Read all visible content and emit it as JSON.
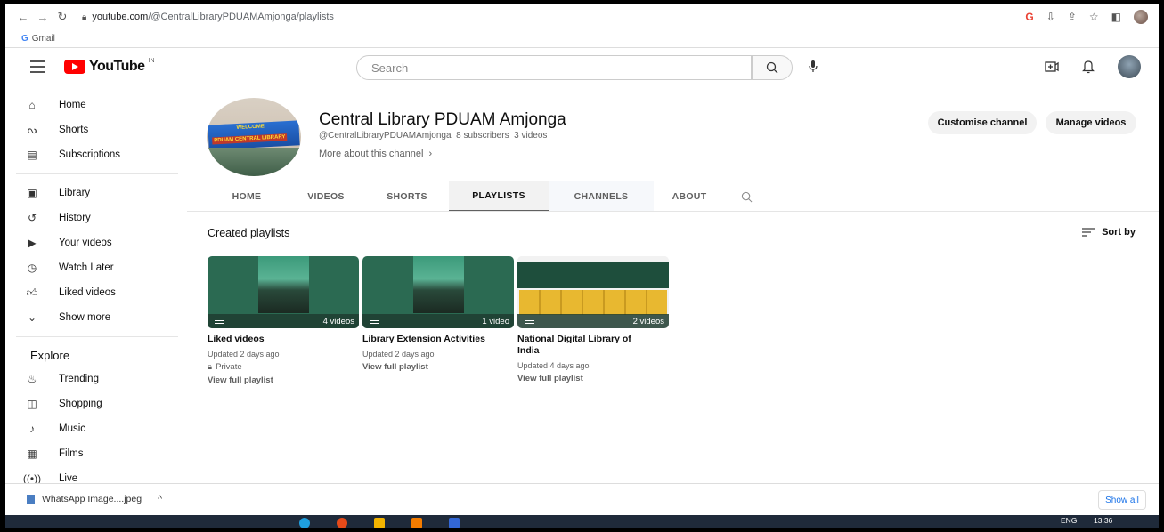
{
  "browser": {
    "url_host": "youtube.com",
    "url_path": "/@CentralLibraryPDUAMAmjonga/playlists",
    "bookmark": "Gmail"
  },
  "header": {
    "logo_text": "YouTube",
    "region": "IN",
    "search_placeholder": "Search"
  },
  "sidebar": {
    "main": [
      {
        "label": "Home",
        "icon": "home-icon"
      },
      {
        "label": "Shorts",
        "icon": "shorts-icon"
      },
      {
        "label": "Subscriptions",
        "icon": "subscriptions-icon"
      }
    ],
    "library": [
      {
        "label": "Library",
        "icon": "library-icon"
      },
      {
        "label": "History",
        "icon": "history-icon"
      },
      {
        "label": "Your videos",
        "icon": "your-videos-icon"
      },
      {
        "label": "Watch Later",
        "icon": "watch-later-icon"
      },
      {
        "label": "Liked videos",
        "icon": "liked-videos-icon"
      },
      {
        "label": "Show more",
        "icon": "chevron-down-icon"
      }
    ],
    "explore_heading": "Explore",
    "explore": [
      {
        "label": "Trending",
        "icon": "trending-icon"
      },
      {
        "label": "Shopping",
        "icon": "shopping-icon"
      },
      {
        "label": "Music",
        "icon": "music-icon"
      },
      {
        "label": "Films",
        "icon": "films-icon"
      },
      {
        "label": "Live",
        "icon": "live-icon"
      }
    ]
  },
  "channel": {
    "name": "Central Library PDUAM Amjonga",
    "handle": "@CentralLibraryPDUAMAmjonga",
    "subscribers": "8 subscribers",
    "videos": "3 videos",
    "more_about": "More about this channel",
    "avatar_sign_line1": "WELCOME",
    "avatar_sign_line2": "PDUAM CENTRAL LIBRARY",
    "customise_label": "Customise channel",
    "manage_label": "Manage videos"
  },
  "tabs": [
    {
      "label": "HOME",
      "active": false
    },
    {
      "label": "VIDEOS",
      "active": false
    },
    {
      "label": "SHORTS",
      "active": false
    },
    {
      "label": "PLAYLISTS",
      "active": true
    },
    {
      "label": "CHANNELS",
      "active": false
    },
    {
      "label": "ABOUT",
      "active": false
    }
  ],
  "content": {
    "section_title": "Created playlists",
    "sort_label": "Sort by",
    "playlists": [
      {
        "title": "Liked videos",
        "count": "4 videos",
        "updated": "Updated 2 days ago",
        "private_label": "Private",
        "view_full": "View full playlist"
      },
      {
        "title": "Library Extension Activities",
        "count": "1 video",
        "updated": "Updated 2 days ago",
        "view_full": "View full playlist"
      },
      {
        "title": "National Digital Library of India",
        "count": "2 videos",
        "updated": "Updated 4 days ago",
        "view_full": "View full playlist"
      }
    ]
  },
  "downloads": {
    "file_name": "WhatsApp Image....jpeg",
    "show_all": "Show all"
  },
  "taskbar": {
    "lang": "ENG",
    "time": "13:36"
  },
  "colors": {
    "brand_red": "#ff0000",
    "thumb_green": "#2b6a52"
  }
}
